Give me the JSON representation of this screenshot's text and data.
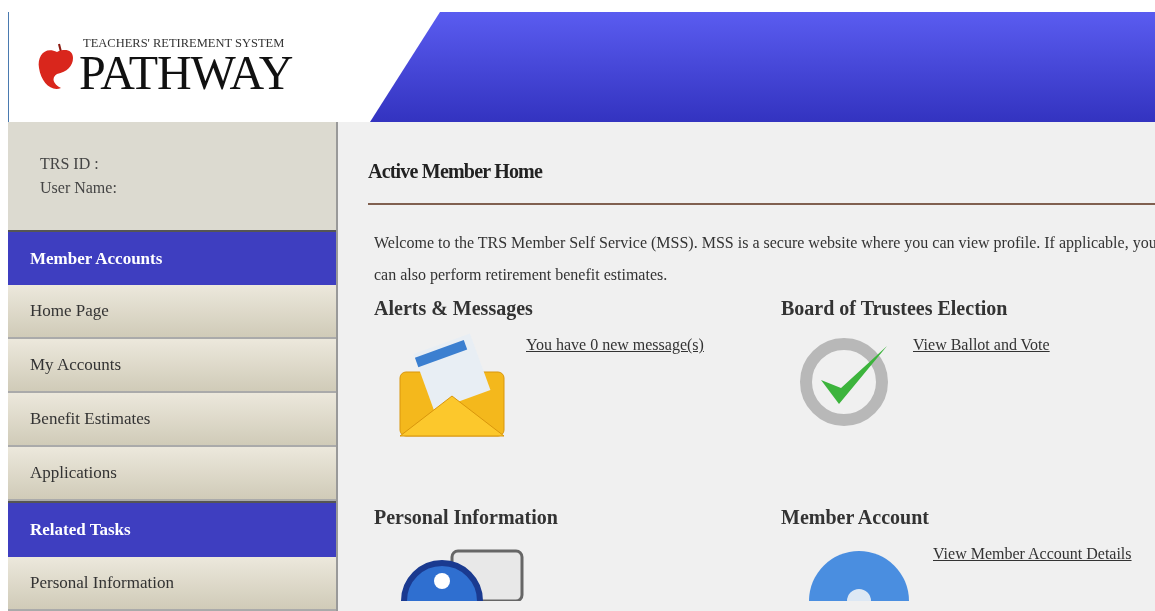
{
  "logo": {
    "tagline": "TEACHERS' RETIREMENT SYSTEM",
    "name": "PATHWAY"
  },
  "sidebar": {
    "info": [
      "TRS ID :",
      "User Name:"
    ],
    "items": [
      {
        "kind": "header",
        "label": "Member Accounts"
      },
      {
        "kind": "link",
        "label": "Home Page"
      },
      {
        "kind": "link",
        "label": "My Accounts"
      },
      {
        "kind": "link",
        "label": "Benefit Estimates"
      },
      {
        "kind": "link",
        "label": "Applications"
      },
      {
        "kind": "header",
        "label": "Related Tasks"
      },
      {
        "kind": "link",
        "label": "Personal Information"
      }
    ]
  },
  "page": {
    "title": "Active Member Home",
    "intro": "Welcome to the TRS Member Self Service (MSS). MSS is a secure website where you can view profile. If applicable, you can also perform retirement benefit estimates.",
    "sections": [
      {
        "kind": "envelope",
        "title": "Alerts & Messages",
        "link": "You have 0 new message(s)"
      },
      {
        "kind": "check",
        "title": "Board of Trustees Election",
        "link": "View Ballot and Vote"
      },
      {
        "kind": "person",
        "title": "Personal Information"
      },
      {
        "kind": "account",
        "title": "Member Account",
        "link": "View Member Account Details"
      }
    ]
  }
}
